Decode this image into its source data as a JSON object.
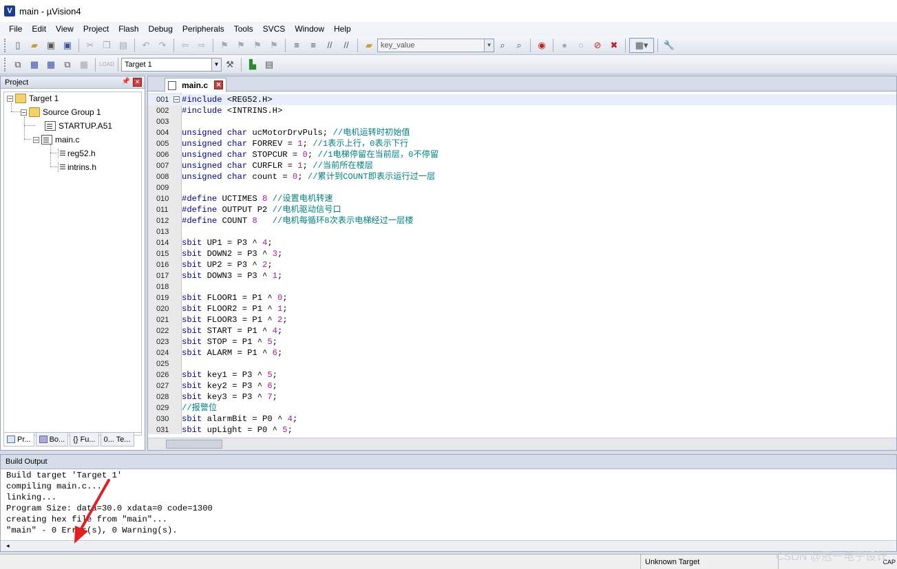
{
  "window": {
    "title": "main  - µVision4",
    "app_icon": "V"
  },
  "menu": [
    "File",
    "Edit",
    "View",
    "Project",
    "Flash",
    "Debug",
    "Peripherals",
    "Tools",
    "SVCS",
    "Window",
    "Help"
  ],
  "toolbar1": {
    "find_combo": "key_value"
  },
  "toolbar2": {
    "target_combo": "Target 1"
  },
  "project_panel": {
    "title": "Project",
    "tree": [
      {
        "label": "Target 1",
        "expander": "−"
      },
      {
        "label": "Source Group 1",
        "expander": "−"
      },
      {
        "label": "STARTUP.A51"
      },
      {
        "label": "main.c",
        "expander": "−"
      },
      {
        "label": "reg52.h"
      },
      {
        "label": "intrins.h"
      }
    ],
    "tabs": [
      "Pr...",
      "Bo...",
      "{} Fu...",
      "0... Te..."
    ]
  },
  "editor": {
    "tab_label": "main.c",
    "lines": [
      {
        "n": "001",
        "segs": [
          [
            "pp",
            "#include "
          ],
          [
            "id",
            "<REG52.H>"
          ]
        ]
      },
      {
        "n": "002",
        "segs": [
          [
            "pp",
            "#include "
          ],
          [
            "id",
            "<INTRINS.H>"
          ]
        ]
      },
      {
        "n": "003",
        "segs": []
      },
      {
        "n": "004",
        "segs": [
          [
            "kw",
            "unsigned char "
          ],
          [
            "id",
            "ucMotorDrvPuls; "
          ],
          [
            "cm",
            "//电机运转时初始值"
          ]
        ]
      },
      {
        "n": "005",
        "segs": [
          [
            "kw",
            "unsigned char "
          ],
          [
            "id",
            "FORREV = "
          ],
          [
            "num",
            "1"
          ],
          [
            "id",
            "; "
          ],
          [
            "cm",
            "//1表示上行，0表示下行"
          ]
        ]
      },
      {
        "n": "006",
        "segs": [
          [
            "kw",
            "unsigned char "
          ],
          [
            "id",
            "STOPCUR = "
          ],
          [
            "num",
            "0"
          ],
          [
            "id",
            "; "
          ],
          [
            "cm",
            "//1电梯停留在当前层，0不停留"
          ]
        ]
      },
      {
        "n": "007",
        "segs": [
          [
            "kw",
            "unsigned char "
          ],
          [
            "id",
            "CURFLR = "
          ],
          [
            "num",
            "1"
          ],
          [
            "id",
            "; "
          ],
          [
            "cm",
            "//当前所在楼层"
          ]
        ]
      },
      {
        "n": "008",
        "segs": [
          [
            "kw",
            "unsigned char "
          ],
          [
            "id",
            "count = "
          ],
          [
            "num",
            "0"
          ],
          [
            "id",
            "; "
          ],
          [
            "cm",
            "//累计到COUNT即表示运行过一层"
          ]
        ]
      },
      {
        "n": "009",
        "segs": []
      },
      {
        "n": "010",
        "segs": [
          [
            "pp",
            "#define "
          ],
          [
            "id",
            "UCTIMES "
          ],
          [
            "num",
            "8"
          ],
          [
            "id",
            " "
          ],
          [
            "cm",
            "//设置电机转速"
          ]
        ]
      },
      {
        "n": "011",
        "segs": [
          [
            "pp",
            "#define "
          ],
          [
            "id",
            "OUTPUT P2 "
          ],
          [
            "cm",
            "//电机驱动信号口"
          ]
        ]
      },
      {
        "n": "012",
        "segs": [
          [
            "pp",
            "#define "
          ],
          [
            "id",
            "COUNT "
          ],
          [
            "num",
            "8"
          ],
          [
            "id",
            "   "
          ],
          [
            "cm",
            "//电机每循环8次表示电梯经过一层楼"
          ]
        ]
      },
      {
        "n": "013",
        "segs": []
      },
      {
        "n": "014",
        "segs": [
          [
            "kw",
            "sbit "
          ],
          [
            "id",
            "UP1 = P3 ^ "
          ],
          [
            "num",
            "4"
          ],
          [
            "id",
            ";"
          ]
        ]
      },
      {
        "n": "015",
        "segs": [
          [
            "kw",
            "sbit "
          ],
          [
            "id",
            "DOWN2 = P3 ^ "
          ],
          [
            "num",
            "3"
          ],
          [
            "id",
            ";"
          ]
        ]
      },
      {
        "n": "016",
        "segs": [
          [
            "kw",
            "sbit "
          ],
          [
            "id",
            "UP2 = P3 ^ "
          ],
          [
            "num",
            "2"
          ],
          [
            "id",
            ";"
          ]
        ]
      },
      {
        "n": "017",
        "segs": [
          [
            "kw",
            "sbit "
          ],
          [
            "id",
            "DOWN3 = P3 ^ "
          ],
          [
            "num",
            "1"
          ],
          [
            "id",
            ";"
          ]
        ]
      },
      {
        "n": "018",
        "segs": []
      },
      {
        "n": "019",
        "segs": [
          [
            "kw",
            "sbit "
          ],
          [
            "id",
            "FLOOR1 = P1 ^ "
          ],
          [
            "num",
            "0"
          ],
          [
            "id",
            ";"
          ]
        ]
      },
      {
        "n": "020",
        "segs": [
          [
            "kw",
            "sbit "
          ],
          [
            "id",
            "FLOOR2 = P1 ^ "
          ],
          [
            "num",
            "1"
          ],
          [
            "id",
            ";"
          ]
        ]
      },
      {
        "n": "021",
        "segs": [
          [
            "kw",
            "sbit "
          ],
          [
            "id",
            "FLOOR3 = P1 ^ "
          ],
          [
            "num",
            "2"
          ],
          [
            "id",
            ";"
          ]
        ]
      },
      {
        "n": "022",
        "segs": [
          [
            "kw",
            "sbit "
          ],
          [
            "id",
            "START = P1 ^ "
          ],
          [
            "num",
            "4"
          ],
          [
            "id",
            ";"
          ]
        ]
      },
      {
        "n": "023",
        "segs": [
          [
            "kw",
            "sbit "
          ],
          [
            "id",
            "STOP = P1 ^ "
          ],
          [
            "num",
            "5"
          ],
          [
            "id",
            ";"
          ]
        ]
      },
      {
        "n": "024",
        "segs": [
          [
            "kw",
            "sbit "
          ],
          [
            "id",
            "ALARM = P1 ^ "
          ],
          [
            "num",
            "6"
          ],
          [
            "id",
            ";"
          ]
        ]
      },
      {
        "n": "025",
        "segs": []
      },
      {
        "n": "026",
        "segs": [
          [
            "kw",
            "sbit "
          ],
          [
            "id",
            "key1 = P3 ^ "
          ],
          [
            "num",
            "5"
          ],
          [
            "id",
            ";"
          ]
        ]
      },
      {
        "n": "027",
        "segs": [
          [
            "kw",
            "sbit "
          ],
          [
            "id",
            "key2 = P3 ^ "
          ],
          [
            "num",
            "6"
          ],
          [
            "id",
            ";"
          ]
        ]
      },
      {
        "n": "028",
        "segs": [
          [
            "kw",
            "sbit "
          ],
          [
            "id",
            "key3 = P3 ^ "
          ],
          [
            "num",
            "7"
          ],
          [
            "id",
            ";"
          ]
        ]
      },
      {
        "n": "029",
        "segs": [
          [
            "cm",
            "//报警位"
          ]
        ]
      },
      {
        "n": "030",
        "segs": [
          [
            "kw",
            "sbit "
          ],
          [
            "id",
            "alarmBit = P0 ^ "
          ],
          [
            "num",
            "4"
          ],
          [
            "id",
            ";"
          ]
        ]
      },
      {
        "n": "031",
        "segs": [
          [
            "kw",
            "sbit "
          ],
          [
            "id",
            "upLight = P0 ^ "
          ],
          [
            "num",
            "5"
          ],
          [
            "id",
            ";"
          ]
        ]
      }
    ]
  },
  "build_output": {
    "title": "Build Output",
    "lines": [
      "Build target 'Target 1'",
      "compiling main.c...",
      "linking...",
      "Program Size: data=30.0 xdata=0 code=1300",
      "creating hex file from \"main\"...",
      "\"main\" - 0 Error(s), 0 Warning(s)."
    ],
    "scroll_glyph": "◂"
  },
  "status": {
    "target": "Unknown Target",
    "caps": "CAP"
  },
  "watermark": "CSDN @冠一电子设计",
  "colors": {
    "annotation_arrow": "#e02020",
    "keyword": "#00007f",
    "comment": "#008080",
    "number": "#a020a0"
  }
}
